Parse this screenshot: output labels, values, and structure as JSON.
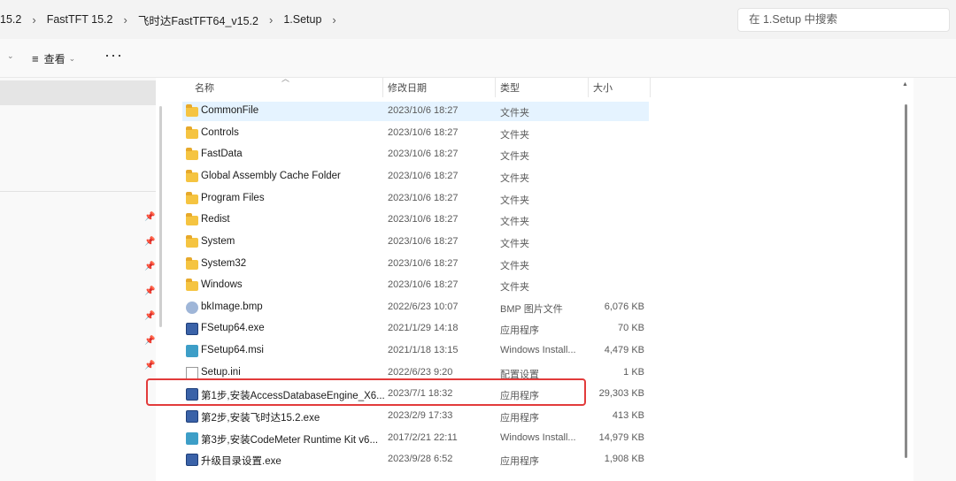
{
  "address": {
    "crumbs": [
      "15.2",
      "FastTFT 15.2",
      "飞时达FastTFT64_v15.2",
      "1.Setup"
    ],
    "separator": "›",
    "search_placeholder": "在 1.Setup 中搜索"
  },
  "toolbar": {
    "view_label": "查看",
    "more_label": "···"
  },
  "columns": {
    "name": "名称",
    "date": "修改日期",
    "type": "类型",
    "size": "大小"
  },
  "files": [
    {
      "name": "CommonFile",
      "date": "2023/10/6 18:27",
      "type": "文件夹",
      "size": "",
      "icon": "folder-icon"
    },
    {
      "name": "Controls",
      "date": "2023/10/6 18:27",
      "type": "文件夹",
      "size": "",
      "icon": "folder-icon"
    },
    {
      "name": "FastData",
      "date": "2023/10/6 18:27",
      "type": "文件夹",
      "size": "",
      "icon": "folder-icon"
    },
    {
      "name": "Global Assembly Cache Folder",
      "date": "2023/10/6 18:27",
      "type": "文件夹",
      "size": "",
      "icon": "folder-icon"
    },
    {
      "name": "Program Files",
      "date": "2023/10/6 18:27",
      "type": "文件夹",
      "size": "",
      "icon": "folder-icon"
    },
    {
      "name": "Redist",
      "date": "2023/10/6 18:27",
      "type": "文件夹",
      "size": "",
      "icon": "folder-icon"
    },
    {
      "name": "System",
      "date": "2023/10/6 18:27",
      "type": "文件夹",
      "size": "",
      "icon": "folder-icon"
    },
    {
      "name": "System32",
      "date": "2023/10/6 18:27",
      "type": "文件夹",
      "size": "",
      "icon": "folder-icon"
    },
    {
      "name": "Windows",
      "date": "2023/10/6 18:27",
      "type": "文件夹",
      "size": "",
      "icon": "folder-icon"
    },
    {
      "name": "bkImage.bmp",
      "date": "2022/6/23 10:07",
      "type": "BMP 图片文件",
      "size": "6,076 KB",
      "icon": "image-file-icon"
    },
    {
      "name": "FSetup64.exe",
      "date": "2021/1/29 14:18",
      "type": "应用程序",
      "size": "70 KB",
      "icon": "exe-file-icon"
    },
    {
      "name": "FSetup64.msi",
      "date": "2021/1/18 13:15",
      "type": "Windows Install...",
      "size": "4,479 KB",
      "icon": "msi-file-icon"
    },
    {
      "name": "Setup.ini",
      "date": "2022/6/23 9:20",
      "type": "配置设置",
      "size": "1 KB",
      "icon": "ini-file-icon"
    },
    {
      "name": "第1步,安装AccessDatabaseEngine_X6...",
      "date": "2023/7/1 18:32",
      "type": "应用程序",
      "size": "29,303 KB",
      "icon": "exe-file-icon"
    },
    {
      "name": "第2步,安装飞时达15.2.exe",
      "date": "2023/2/9 17:33",
      "type": "应用程序",
      "size": "413 KB",
      "icon": "exe-file-icon"
    },
    {
      "name": "第3步,安装CodeMeter Runtime Kit v6...",
      "date": "2017/2/21 22:11",
      "type": "Windows Install...",
      "size": "14,979 KB",
      "icon": "msi-file-icon"
    },
    {
      "name": "升级目录设置.exe",
      "date": "2023/9/28 6:52",
      "type": "应用程序",
      "size": "1,908 KB",
      "icon": "exe-file-icon"
    }
  ],
  "colors": {
    "selection": "#e5f3ff",
    "highlight_box": "#e23b3b",
    "folder": "#f5c441"
  }
}
